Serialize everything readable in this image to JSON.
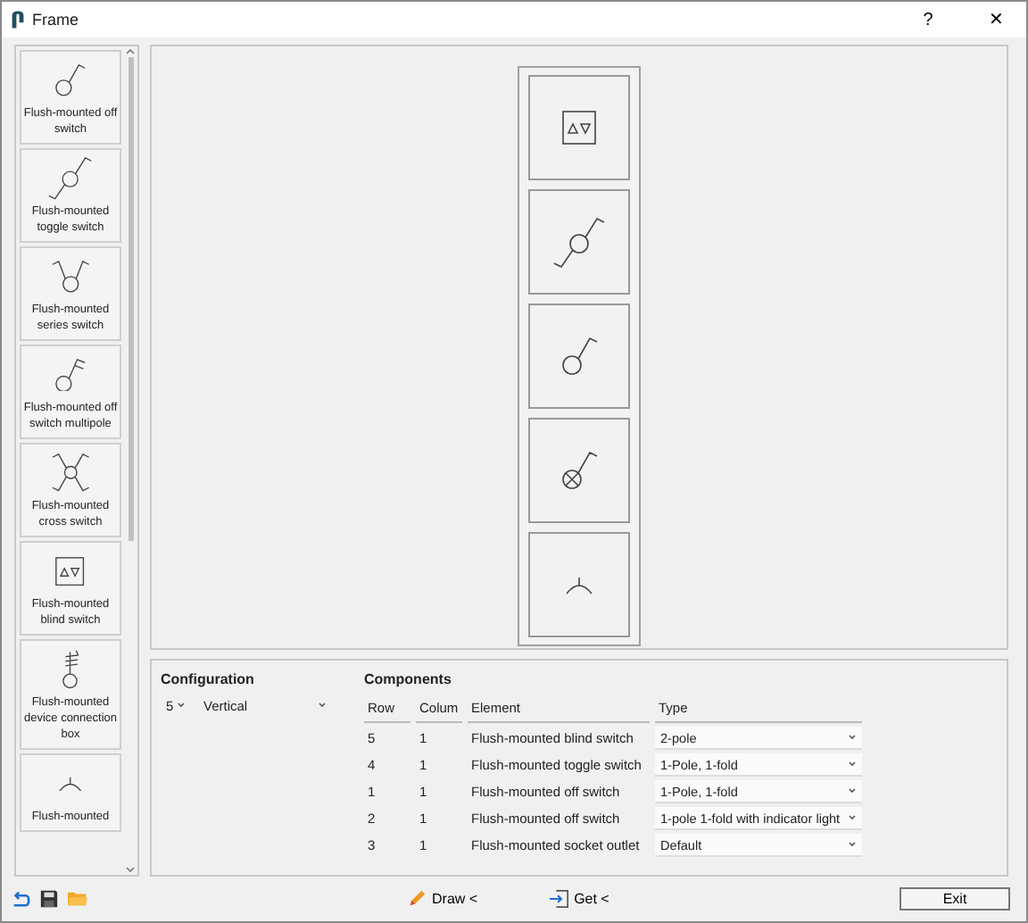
{
  "window": {
    "title": "Frame",
    "help": "?",
    "close": "✕"
  },
  "library": [
    {
      "label": "Flush-mounted off switch",
      "kind": "off"
    },
    {
      "label": "Flush-mounted toggle switch",
      "kind": "toggle"
    },
    {
      "label": "Flush-mounted series switch",
      "kind": "series"
    },
    {
      "label": "Flush-mounted off switch multipole",
      "kind": "multipole"
    },
    {
      "label": "Flush-mounted cross switch",
      "kind": "cross"
    },
    {
      "label": "Flush-mounted blind switch",
      "kind": "blind"
    },
    {
      "label": "Flush-mounted device connection box",
      "kind": "connection"
    },
    {
      "label": "Flush-mounted",
      "kind": "socket"
    }
  ],
  "frame_cells": [
    {
      "kind": "blind"
    },
    {
      "kind": "toggle"
    },
    {
      "kind": "off"
    },
    {
      "kind": "indicator"
    },
    {
      "kind": "socket"
    }
  ],
  "configuration": {
    "title": "Configuration",
    "count": "5",
    "orientation": "Vertical"
  },
  "components": {
    "title": "Components",
    "columns": [
      "Row",
      "Colum",
      "Element",
      "Type"
    ],
    "rows": [
      {
        "row": "5",
        "column": "1",
        "element": "Flush-mounted blind switch",
        "type": "2-pole"
      },
      {
        "row": "4",
        "column": "1",
        "element": "Flush-mounted toggle switch",
        "type": "1-Pole, 1-fold"
      },
      {
        "row": "1",
        "column": "1",
        "element": "Flush-mounted off switch",
        "type": "1-Pole, 1-fold"
      },
      {
        "row": "2",
        "column": "1",
        "element": "Flush-mounted off switch",
        "type": "1-pole 1-fold with indicator light"
      },
      {
        "row": "3",
        "column": "1",
        "element": "Flush-mounted socket outlet",
        "type": "Default"
      }
    ]
  },
  "footer": {
    "draw": "Draw <",
    "get": "Get <",
    "exit": "Exit"
  }
}
